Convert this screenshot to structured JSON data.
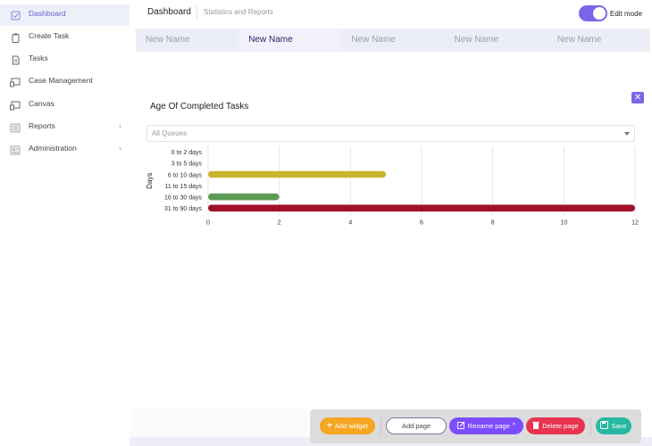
{
  "sidebar": {
    "items": [
      {
        "label": "Dashboard",
        "icon": "check-square-icon",
        "active": true
      },
      {
        "label": "Create Task",
        "icon": "clipboard-icon"
      },
      {
        "label": "Tasks",
        "icon": "document-icon"
      },
      {
        "label": "Case Management",
        "icon": "monitor-icon"
      },
      {
        "label": "Canvas",
        "icon": "monitor-icon"
      },
      {
        "label": "Reports",
        "icon": "report-icon",
        "has_submenu": true
      },
      {
        "label": "Administration",
        "icon": "admin-icon",
        "has_submenu": true
      }
    ]
  },
  "header": {
    "title": "Dashboard",
    "subtitle": "Statistics and Reports",
    "edit_mode_label": "Edit mode",
    "edit_mode_on": true
  },
  "tabs": [
    {
      "label": "New Name"
    },
    {
      "label": "New Name",
      "active": true
    },
    {
      "label": "New Name"
    },
    {
      "label": "New Name"
    },
    {
      "label": "New Name"
    }
  ],
  "widget": {
    "close_icon": "close-icon",
    "queue_select": {
      "value": "All Queues"
    }
  },
  "chart_data": {
    "type": "bar",
    "orientation": "horizontal",
    "title": "Age Of Completed Tasks",
    "ylabel": "Days",
    "xlabel": "",
    "categories": [
      "0 to 2 days",
      "3 to 5 days",
      "6 to 10 days",
      "11 to 15 days",
      "16 to 30 days",
      "31 to 90 days"
    ],
    "values": [
      0,
      0,
      5,
      0,
      2,
      12
    ],
    "colors": [
      "#c8b52f",
      "#c8b52f",
      "#c8b52f",
      "#c8b52f",
      "#5c9c54",
      "#a1102a"
    ],
    "xlim": [
      0,
      12
    ],
    "xticks": [
      0,
      2,
      4,
      6,
      8,
      10,
      12
    ],
    "grid": true
  },
  "actions": {
    "add_widget": "Add widget",
    "add_page": "Add page",
    "rename_page": "Rename page",
    "delete_page": "Delete page",
    "save": "Save"
  },
  "colors": {
    "accent": "#7c65e6",
    "add_widget": "#f5a623",
    "rename": "#7c4dff",
    "delete": "#e8344e",
    "save": "#26b8a2"
  }
}
